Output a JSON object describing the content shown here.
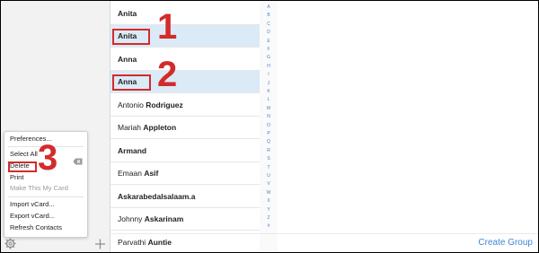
{
  "contacts": [
    {
      "first": "Anita",
      "last": "",
      "selected": false,
      "bold_first": true
    },
    {
      "first": "Anita",
      "last": "",
      "selected": true,
      "bold_first": true
    },
    {
      "first": "Anna",
      "last": "",
      "selected": false,
      "bold_first": true
    },
    {
      "first": "Anna",
      "last": "",
      "selected": true,
      "bold_first": true
    },
    {
      "first": "Antonio",
      "last": "Rodriguez",
      "selected": false,
      "bold_first": false
    },
    {
      "first": "Mariah",
      "last": "Appleton",
      "selected": false,
      "bold_first": false
    },
    {
      "first": "Armand",
      "last": "",
      "selected": false,
      "bold_first": true
    },
    {
      "first": "Emaan",
      "last": "Asif",
      "selected": false,
      "bold_first": false
    },
    {
      "first": "Askarabedalsalaam.a",
      "last": "",
      "selected": false,
      "bold_first": true
    },
    {
      "first": "Johnny",
      "last": "Askarinam",
      "selected": false,
      "bold_first": false
    },
    {
      "first": "Parvathi",
      "last": "Auntie",
      "selected": false,
      "bold_first": false
    }
  ],
  "index_letters": [
    "A",
    "B",
    "C",
    "D",
    "E",
    "F",
    "G",
    "H",
    "I",
    "J",
    "K",
    "L",
    "M",
    "N",
    "O",
    "P",
    "Q",
    "R",
    "S",
    "T",
    "U",
    "V",
    "W",
    "X",
    "Y",
    "Z",
    "#"
  ],
  "menu": {
    "items": [
      {
        "label": "Preferences...",
        "enabled": true
      },
      {
        "label": "Select All",
        "enabled": true
      },
      {
        "label": "Delete",
        "enabled": true
      },
      {
        "label": "Print",
        "enabled": true
      },
      {
        "label": "Make This My Card",
        "enabled": false
      },
      {
        "label": "Import vCard...",
        "enabled": true
      },
      {
        "label": "Export vCard...",
        "enabled": true
      },
      {
        "label": "Refresh Contacts",
        "enabled": true
      }
    ]
  },
  "annotations": {
    "one": "1",
    "two": "2",
    "three": "3"
  },
  "footer": {
    "create_group": "Create Group"
  },
  "colors": {
    "accent": "#3f86d6",
    "annotation": "#d32b2b",
    "selection": "#dbeaf7"
  },
  "icons": {
    "settings": "gear-icon",
    "add": "plus-icon",
    "delete_key": "backspace-icon"
  }
}
